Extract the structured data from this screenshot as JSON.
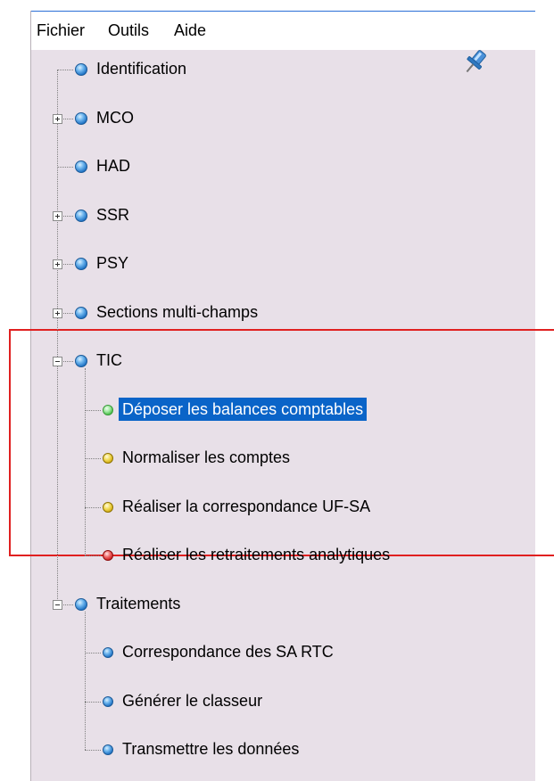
{
  "menu": {
    "items": [
      "Fichier",
      "Outils",
      "Aide"
    ]
  },
  "toolbar": {
    "pin_icon": "pin-icon"
  },
  "tree": {
    "nodes": [
      {
        "label": "Identification",
        "status": "blue"
      },
      {
        "label": "MCO",
        "status": "blue",
        "expander": "plus"
      },
      {
        "label": "HAD",
        "status": "blue"
      },
      {
        "label": "SSR",
        "status": "blue",
        "expander": "plus"
      },
      {
        "label": "PSY",
        "status": "blue",
        "expander": "plus"
      },
      {
        "label": "Sections multi-champs",
        "status": "blue",
        "expander": "plus"
      },
      {
        "label": "TIC",
        "status": "blue",
        "expander": "minus",
        "children": [
          {
            "label": "Déposer les balances comptables",
            "status": "green",
            "selected": true
          },
          {
            "label": "Normaliser les comptes",
            "status": "yellow"
          },
          {
            "label": "Réaliser la correspondance UF-SA",
            "status": "yellow"
          },
          {
            "label": "Réaliser les retraitements analytiques",
            "status": "red"
          }
        ]
      },
      {
        "label": "Traitements",
        "status": "blue",
        "expander": "minus",
        "children": [
          {
            "label": "Correspondance des SA RTC",
            "status": "blue"
          },
          {
            "label": "Générer le classeur",
            "status": "blue"
          },
          {
            "label": "Transmettre les données",
            "status": "blue"
          }
        ]
      }
    ]
  },
  "colors": {
    "panel_bg": "#e8e0e8",
    "selection": "#0a64c8",
    "highlight_border": "#e02020"
  }
}
